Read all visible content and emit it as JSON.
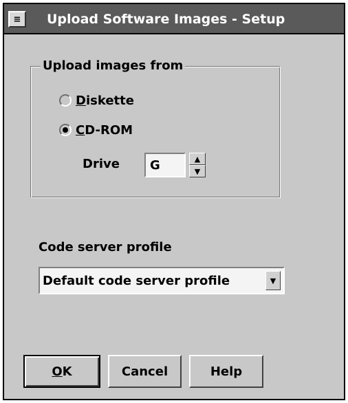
{
  "window": {
    "title": "Upload Software Images - Setup",
    "system_menu_icon": "sysmenu-icon"
  },
  "upload_group": {
    "title": "Upload images from",
    "options": [
      {
        "mnemonic": "D",
        "rest": "iskette",
        "label": "Diskette",
        "checked": false
      },
      {
        "mnemonic": "C",
        "rest": "D-ROM",
        "label": "CD-ROM",
        "checked": true
      }
    ],
    "drive": {
      "label": "Drive",
      "value": "G"
    }
  },
  "code_server": {
    "label": "Code server profile",
    "selected": "Default code server profile"
  },
  "buttons": {
    "ok_mnemonic": "O",
    "ok_rest": "K",
    "cancel": "Cancel",
    "help": "Help"
  },
  "colors": {
    "titlebar": "#5a5a5a",
    "dialog_bg": "#c8c8c8",
    "field_bg": "#f4f4f4"
  }
}
